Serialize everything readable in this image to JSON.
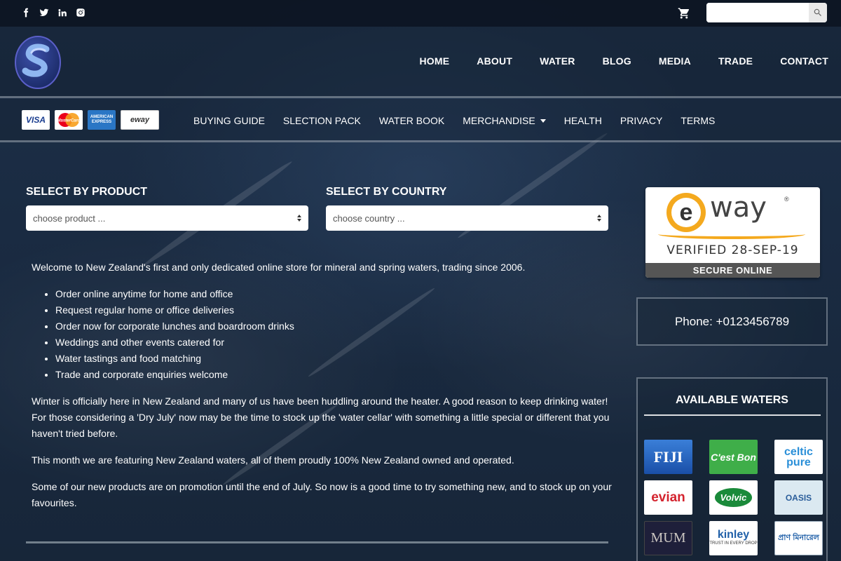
{
  "topbar": {
    "social_icons": [
      "facebook-icon",
      "twitter-icon",
      "linkedin-icon",
      "instagram-icon"
    ],
    "cart_icon": "cart-icon",
    "search": {
      "value": "",
      "placeholder": "",
      "icon": "search-icon"
    }
  },
  "header": {
    "logo": "S",
    "nav": [
      "HOME",
      "ABOUT",
      "WATER",
      "BLOG",
      "MEDIA",
      "TRADE",
      "CONTACT"
    ]
  },
  "subheader": {
    "payment_cards": {
      "visa": "VISA",
      "mastercard": "MasterCard",
      "amex": "AMERICAN EXPRESS",
      "eway": "eway"
    },
    "nav": [
      "BUYING GUIDE",
      "SLECTION PACK",
      "WATER BOOK",
      "MERCHANDISE",
      "HEALTH",
      "PRIVACY",
      "TERMS"
    ]
  },
  "filters": {
    "product_label": "SELECT BY PRODUCT",
    "product_value": "choose product ...",
    "country_label": "SELECT BY COUNTRY",
    "country_value": "choose country ..."
  },
  "content": {
    "intro": "Welcome to New Zealand's first and only dedicated online store for mineral and spring waters, trading since 2006.",
    "bullets": [
      "Order online anytime for home and office",
      "Request regular home or office deliveries",
      "Order now for corporate lunches and boardroom drinks",
      "Weddings and other events catered for",
      "Water tastings and food matching",
      "Trade and corporate enquiries welcome"
    ],
    "para1": "Winter is officially here in New Zealand and many of us have been huddling around the heater. A good reason to keep drinking water! For those considering a 'Dry July' now may be the time to stock up the 'water cellar' with something a little special or different that you haven't tried before.",
    "para2": "This month we are featuring New Zealand waters, all of them proudly 100% New Zealand owned and operated.",
    "para3": "Some of our new products are on promotion until the end of July. So now is a good time to try something new, and to stock up on your favourites."
  },
  "sidebar": {
    "eway_badge": {
      "word": "way",
      "e": "e",
      "reg": "®",
      "verified": "VERIFIED 28-SEP-19",
      "secure": "SECURE ONLINE"
    },
    "phone": "Phone: +0123456789",
    "waters_title": "AVAILABLE WATERS",
    "waters": {
      "fiji": "FIJI",
      "cestbon": "C'est Bon",
      "celtic": "celtic pure",
      "evian": "evian",
      "volvic": "Volvic",
      "oasis": "OASIS",
      "mum": "MUM",
      "kinley": "kinley",
      "kinley_tag": "TRUST IN EVERY DROP",
      "bangla": "প্রাণ মিনারেল"
    }
  }
}
